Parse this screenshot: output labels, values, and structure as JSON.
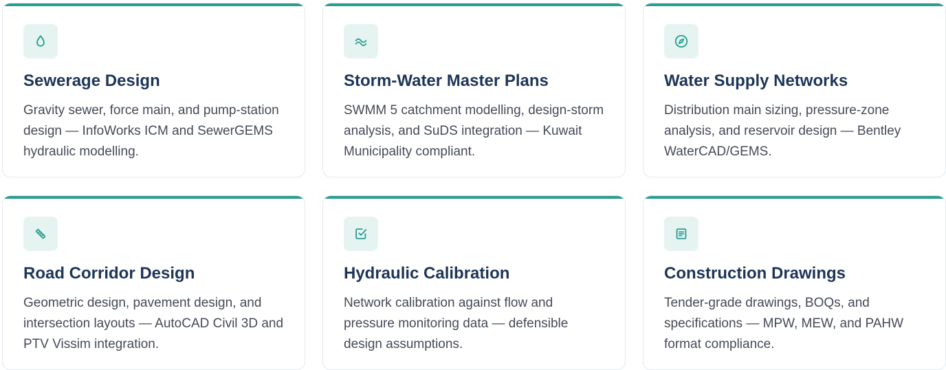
{
  "colors": {
    "accent": "#2a9d8f",
    "icon_bg": "#e6f4f1",
    "title": "#1d3557",
    "text": "#444a55",
    "border": "#e3e8ee"
  },
  "cards": [
    {
      "icon": "droplet-icon",
      "title": "Sewerage Design",
      "description": "Gravity sewer, force main, and pump-station design — InfoWorks ICM and SewerGEMS hydraulic modelling."
    },
    {
      "icon": "waves-icon",
      "title": "Storm-Water Master Plans",
      "description": "SWMM 5 catchment modelling, design-storm analysis, and SuDS integration — Kuwait Municipality compliant."
    },
    {
      "icon": "compass-icon",
      "title": "Water Supply Networks",
      "description": "Distribution main sizing, pressure-zone analysis, and reservoir design — Bentley WaterCAD/GEMS."
    },
    {
      "icon": "ruler-icon",
      "title": "Road Corridor Design",
      "description": "Geometric design, pavement design, and intersection layouts — AutoCAD Civil 3D and PTV Vissim integration."
    },
    {
      "icon": "checkbox-icon",
      "title": "Hydraulic Calibration",
      "description": "Network calibration against flow and pressure monitoring data — defensible design assumptions."
    },
    {
      "icon": "document-icon",
      "title": "Construction Drawings",
      "description": "Tender-grade drawings, BOQs, and specifications — MPW, MEW, and PAHW format compliance."
    }
  ]
}
